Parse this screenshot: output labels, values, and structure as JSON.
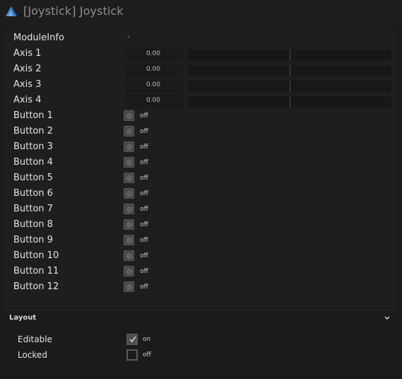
{
  "window": {
    "title": "[Joystick] Joystick",
    "icon": "pyramid-app-icon"
  },
  "module_info": {
    "label": "ModuleInfo",
    "value": "-"
  },
  "axes": [
    {
      "label": "Axis 1",
      "value": "0.00",
      "position": 0.0
    },
    {
      "label": "Axis 2",
      "value": "0.00",
      "position": 0.0
    },
    {
      "label": "Axis 3",
      "value": "0.00",
      "position": 0.0
    },
    {
      "label": "Axis 4",
      "value": "0.00",
      "position": 0.0
    }
  ],
  "buttons": [
    {
      "label": "Button 1",
      "state": "off"
    },
    {
      "label": "Button 2",
      "state": "off"
    },
    {
      "label": "Button 3",
      "state": "off"
    },
    {
      "label": "Button 4",
      "state": "off"
    },
    {
      "label": "Button 5",
      "state": "off"
    },
    {
      "label": "Button 6",
      "state": "off"
    },
    {
      "label": "Button 7",
      "state": "off"
    },
    {
      "label": "Button 8",
      "state": "off"
    },
    {
      "label": "Button 9",
      "state": "off"
    },
    {
      "label": "Button 10",
      "state": "off"
    },
    {
      "label": "Button 11",
      "state": "off"
    },
    {
      "label": "Button 12",
      "state": "off"
    }
  ],
  "layout": {
    "title": "Layout",
    "chevron_icon": "chevron-down-icon",
    "editable": {
      "label": "Editable",
      "state": "on",
      "checked": true
    },
    "locked": {
      "label": "Locked",
      "state": "off",
      "checked": false
    }
  },
  "colors": {
    "background": "#1b1b1b",
    "text": "#e3e3e3",
    "muted_text": "#8f8f8f",
    "control": "#4a4a4a"
  }
}
